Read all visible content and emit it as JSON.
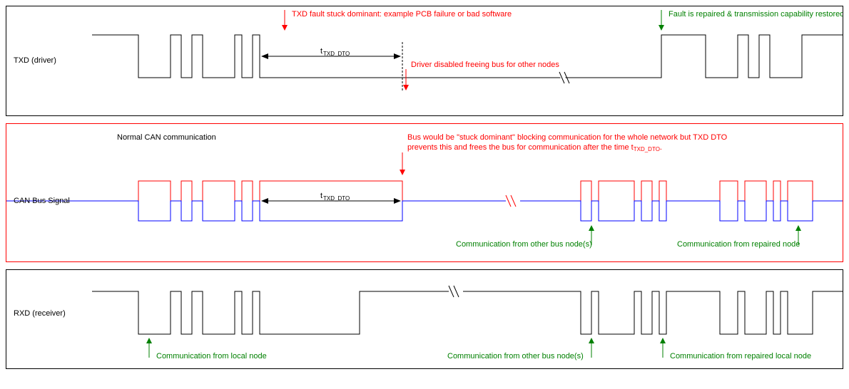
{
  "panel1": {
    "label": "TXD (driver)",
    "annot_fault": "TXD fault stuck dominant: example PCB failure or bad software",
    "annot_repair": "Fault is repaired & transmission capability restored",
    "annot_t": "t",
    "annot_t_sub": "TXD_DTO",
    "annot_driver_disabled": "Driver disabled freeing bus for other nodes"
  },
  "panel2": {
    "label": "CAN Bus Signal",
    "annot_normal": "Normal CAN communication",
    "annot_stuck_line1": "Bus would be \"stuck dominant\" blocking communication for the whole network but TXD DTO",
    "annot_stuck_line2_a": "prevents this and frees the bus for communication after the time t",
    "annot_stuck_line2_sub": "TXD_DTO",
    "annot_stuck_line2_b": ".",
    "annot_t": "t",
    "annot_t_sub": "TXD_DTO",
    "annot_other_node": "Communication from other bus node(s)",
    "annot_repaired_node": "Communication from repaired node"
  },
  "panel3": {
    "label": "RXD (receiver)",
    "annot_local": "Communication from local node",
    "annot_other_node": "Communication from other bus node(s)",
    "annot_repaired_local": "Communication from repaired local node"
  }
}
